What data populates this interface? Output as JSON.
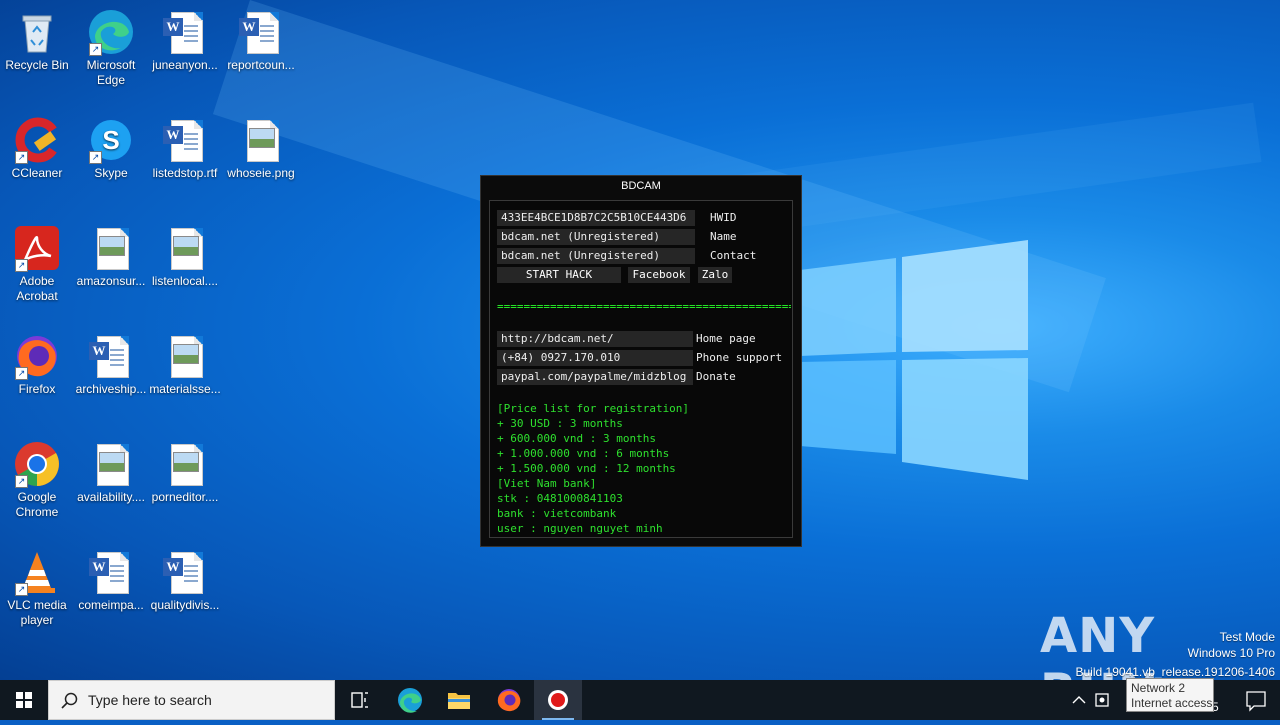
{
  "desktop": {
    "icons": [
      {
        "label": "Recycle Bin",
        "icon": "recycle-bin-icon"
      },
      {
        "label": "Microsoft Edge",
        "icon": "edge-icon"
      },
      {
        "label": "juneanyon...",
        "icon": "word-doc-icon"
      },
      {
        "label": "reportcoun...",
        "icon": "word-doc-icon"
      },
      {
        "label": "CCleaner",
        "icon": "ccleaner-icon"
      },
      {
        "label": "Skype",
        "icon": "skype-icon"
      },
      {
        "label": "listedstop.rtf",
        "icon": "word-doc-icon"
      },
      {
        "label": "whoseie.png",
        "icon": "image-file-icon"
      },
      {
        "label": "Adobe Acrobat",
        "icon": "acrobat-icon"
      },
      {
        "label": "amazonsur...",
        "icon": "image-file-icon"
      },
      {
        "label": "listenlocal....",
        "icon": "image-file-icon"
      },
      {
        "label": "Firefox",
        "icon": "firefox-icon"
      },
      {
        "label": "archiveship...",
        "icon": "word-doc-icon"
      },
      {
        "label": "materialsse...",
        "icon": "image-file-icon"
      },
      {
        "label": "Google Chrome",
        "icon": "chrome-icon"
      },
      {
        "label": "availability....",
        "icon": "image-file-icon"
      },
      {
        "label": "porneditor....",
        "icon": "image-file-icon"
      },
      {
        "label": "VLC media player",
        "icon": "vlc-icon"
      },
      {
        "label": "comeimpa...",
        "icon": "word-doc-icon"
      },
      {
        "label": "qualitydivis...",
        "icon": "word-doc-icon"
      }
    ],
    "word_badge": "W",
    "skype_letter": "S"
  },
  "bdcam": {
    "title": "BDCAM",
    "hwid_value": "433EE4BCE1D8B7C2C5B10CE443D6",
    "hwid_label": "HWID",
    "name_value": "bdcam.net  (Unregistered)",
    "name_label": "Name",
    "contact_value": "bdcam.net  (Unregistered)",
    "contact_label": "Contact",
    "start_hack": "START HACK",
    "facebook": "Facebook",
    "zalo": "Zalo",
    "separator": "=================================================",
    "home_value": "http://bdcam.net/",
    "home_label": "Home page",
    "phone_value": "(+84) 0927.170.010",
    "phone_label": "Phone support",
    "donate_value": "paypal.com/paypalme/midzblog",
    "donate_label": "Donate",
    "price_lines": [
      "[Price list for registration]",
      "+ 30 USD : 3 months",
      "+ 600.000 vnd : 3 months",
      "+ 1.000.000 vnd : 6 months",
      "+ 1.500.000 vnd : 12 months",
      "[Viet Nam bank]",
      "stk : 0481000841103",
      "bank : vietcombank",
      "user : nguyen nguyet minh"
    ]
  },
  "watermark": {
    "text": "ANY RUN",
    "test_mode": "Test Mode",
    "edition": "Windows 10 Pro",
    "build": "Build 19041.vb_release.191206-1406"
  },
  "taskbar": {
    "search_placeholder": "Type here to search",
    "apps": [
      "task-view-icon",
      "edge-icon",
      "file-explorer-icon",
      "firefox-icon",
      "bdcam-record-icon"
    ],
    "tooltip_line1": "Network 2",
    "tooltip_line2": "Internet access",
    "clock_fragment": "5"
  },
  "colors": {
    "accent_green": "#2ee02e",
    "taskbar": "#101820",
    "desktop_blue": "#0a6fd6"
  }
}
